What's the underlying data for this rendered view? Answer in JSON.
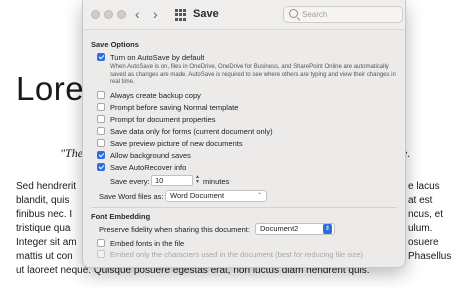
{
  "document": {
    "title": "Lorem",
    "quote_left": "\"The",
    "quote_right": "e.",
    "left_lines": [
      "Sed hendrerit",
      "blandit, quis",
      "finibus nec. I",
      "tristique qua",
      "Integer sit am",
      "mattis ut con",
      "ut laoreet neque. Quisque posuere egestas erat, non luctus diam hendrerit quis."
    ],
    "right_lines": [
      "e lacus",
      "at est",
      "ncus, et",
      "ulum.",
      "osuere",
      "Phasellus"
    ]
  },
  "window": {
    "title": "Save",
    "search_placeholder": "Search"
  },
  "save_options": {
    "heading": "Save Options",
    "autosave_label": "Turn on AutoSave by default",
    "autosave_note": "When AutoSave is on, files in OneDrive, OneDrive for Business, and SharePoint Online are automatically saved as changes are made. AutoSave is required to see where others are typing and view their changes in real time.",
    "options": [
      {
        "label": "Always create backup copy",
        "checked": false
      },
      {
        "label": "Prompt before saving Normal template",
        "checked": false
      },
      {
        "label": "Prompt for document properties",
        "checked": false
      },
      {
        "label": "Save data only for forms (current document only)",
        "checked": false
      },
      {
        "label": "Save preview picture of new documents",
        "checked": false
      },
      {
        "label": "Allow background saves",
        "checked": true
      },
      {
        "label": "Save AutoRecover info",
        "checked": true
      }
    ],
    "save_every_label": "Save every:",
    "save_every_value": "10",
    "minutes_label": "minutes",
    "save_as_label": "Save Word files as:",
    "save_as_value": "Word Document"
  },
  "font_embedding": {
    "heading": "Font Embedding",
    "preserve_label": "Preserve fidelity when sharing this document:",
    "preserve_value": "Document2",
    "embed_label": "Embed fonts in the file",
    "embed_only_label": "Embed only the characters used in the document (best for reducing file size)"
  },
  "colors": {
    "accent": "#2b6fe0",
    "dialog_bg": "#ecebea"
  }
}
